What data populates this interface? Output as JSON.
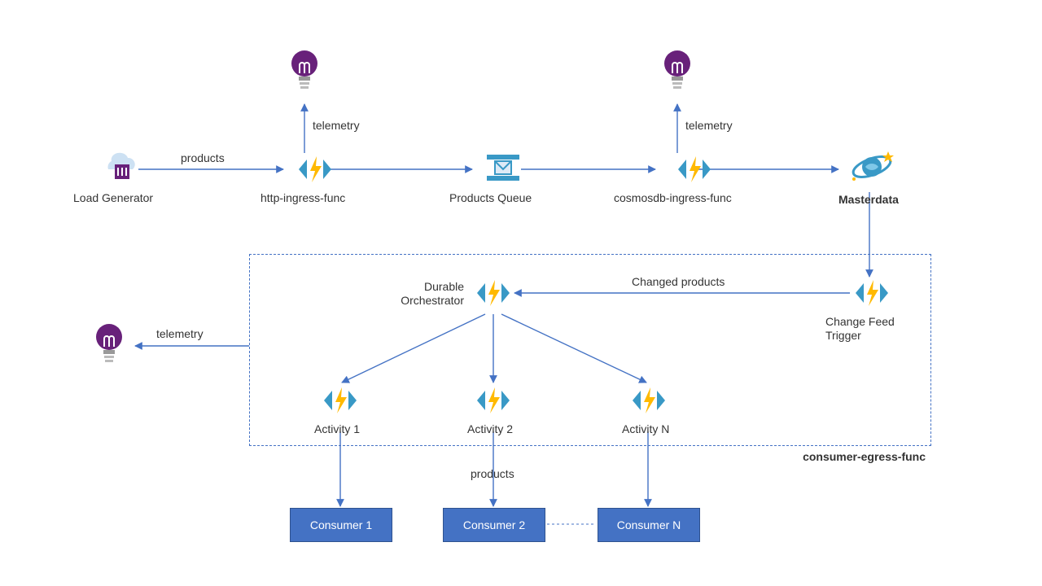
{
  "nodes": {
    "load_generator": "Load Generator",
    "http_ingress": "http-ingress-func",
    "products_queue": "Products Queue",
    "cosmos_ingress": "cosmosdb-ingress-func",
    "masterdata": "Masterdata",
    "durable_orch": "Durable\nOrchestrator",
    "change_feed": "Change Feed\nTrigger",
    "activity1": "Activity 1",
    "activity2": "Activity 2",
    "activityN": "Activity N",
    "consumer1": "Consumer 1",
    "consumer2": "Consumer 2",
    "consumerN": "Consumer N"
  },
  "edges": {
    "products_top": "products",
    "telemetry_http": "telemetry",
    "telemetry_cosmos": "telemetry",
    "changed_products": "Changed products",
    "telemetry_left": "telemetry",
    "products_bottom": "products"
  },
  "group": {
    "consumer_egress": "consumer-egress-func"
  },
  "icons": {
    "bulb": "insights-bulb-icon",
    "func": "azure-function-icon",
    "queue": "storage-queue-icon",
    "cosmos": "cosmos-db-icon",
    "loadgen": "load-generator-icon"
  },
  "colors": {
    "arrow": "#4472C4",
    "consumer_fill": "#4472C4",
    "consumer_border": "#2F528F",
    "bulb": "#68217A",
    "func_bolt": "#FFB900",
    "func_bracket": "#3999C6",
    "cosmos": "#3999C6",
    "queue_frame": "#3999C6"
  }
}
